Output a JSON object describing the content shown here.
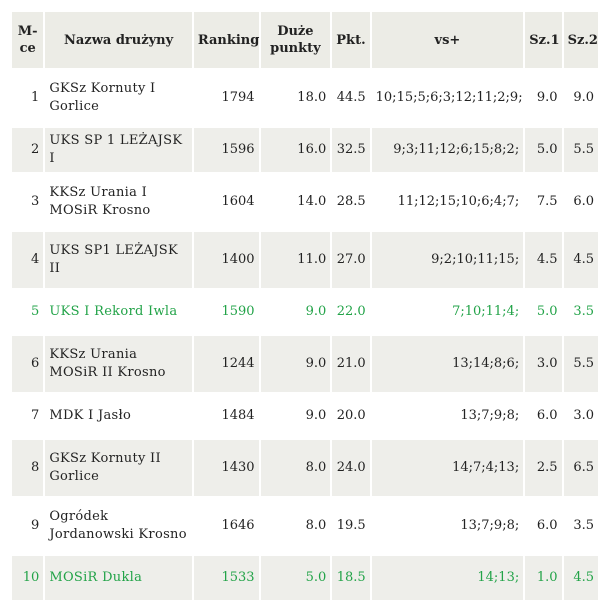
{
  "headers": {
    "place": "M-ce",
    "team": "Nazwa drużyny",
    "ranking": "Ranking",
    "big_points": "Duże punkty",
    "points": "Pkt.",
    "vs": "vs+",
    "sz1": "Sz.1",
    "sz2": "Sz.2"
  },
  "colors": {
    "header_bg": "#ecece6",
    "stripe_bg": "#eeeeea",
    "highlight_text": "#22a348"
  },
  "rows": [
    {
      "place": "1",
      "team": "GKSz Kornuty I Gorlice",
      "ranking": "1794",
      "big_points": "18.0",
      "points": "44.5",
      "vs": "10;15;5;6;3;12;11;2;9;",
      "sz1": "9.0",
      "sz2": "9.0",
      "highlight": false
    },
    {
      "place": "2",
      "team": "UKS SP 1 LEŻAJSK I",
      "ranking": "1596",
      "big_points": "16.0",
      "points": "32.5",
      "vs": "9;3;11;12;6;15;8;2;",
      "sz1": "5.0",
      "sz2": "5.5",
      "highlight": false
    },
    {
      "place": "3",
      "team": "KKSz Urania I MOSiR Krosno",
      "ranking": "1604",
      "big_points": "14.0",
      "points": "28.5",
      "vs": "11;12;15;10;6;4;7;",
      "sz1": "7.5",
      "sz2": "6.0",
      "highlight": false
    },
    {
      "place": "4",
      "team": "UKS SP1 LEŻAJSK II",
      "ranking": "1400",
      "big_points": "11.0",
      "points": "27.0",
      "vs": "9;2;10;11;15;",
      "sz1": "4.5",
      "sz2": "4.5",
      "highlight": false
    },
    {
      "place": "5",
      "team": "UKS I Rekord Iwla",
      "ranking": "1590",
      "big_points": "9.0",
      "points": "22.0",
      "vs": "7;10;11;4;",
      "sz1": "5.0",
      "sz2": "3.5",
      "highlight": true
    },
    {
      "place": "6",
      "team": "KKSz Urania MOSiR II Krosno",
      "ranking": "1244",
      "big_points": "9.0",
      "points": "21.0",
      "vs": "13;14;8;6;",
      "sz1": "3.0",
      "sz2": "5.5",
      "highlight": false
    },
    {
      "place": "7",
      "team": "MDK I Jasło",
      "ranking": "1484",
      "big_points": "9.0",
      "points": "20.0",
      "vs": "13;7;9;8;",
      "sz1": "6.0",
      "sz2": "3.0",
      "highlight": false
    },
    {
      "place": "8",
      "team": "GKSz Kornuty II Gorlice",
      "ranking": "1430",
      "big_points": "8.0",
      "points": "24.0",
      "vs": "14;7;4;13;",
      "sz1": "2.5",
      "sz2": "6.5",
      "highlight": false
    },
    {
      "place": "9",
      "team": "Ogródek Jordanowski Krosno",
      "ranking": "1646",
      "big_points": "8.0",
      "points": "19.5",
      "vs": "13;7;9;8;",
      "sz1": "6.0",
      "sz2": "3.5",
      "highlight": false
    },
    {
      "place": "10",
      "team": "MOSiR Dukla",
      "ranking": "1533",
      "big_points": "5.0",
      "points": "18.5",
      "vs": "14;13;",
      "sz1": "1.0",
      "sz2": "4.5",
      "highlight": true
    }
  ]
}
